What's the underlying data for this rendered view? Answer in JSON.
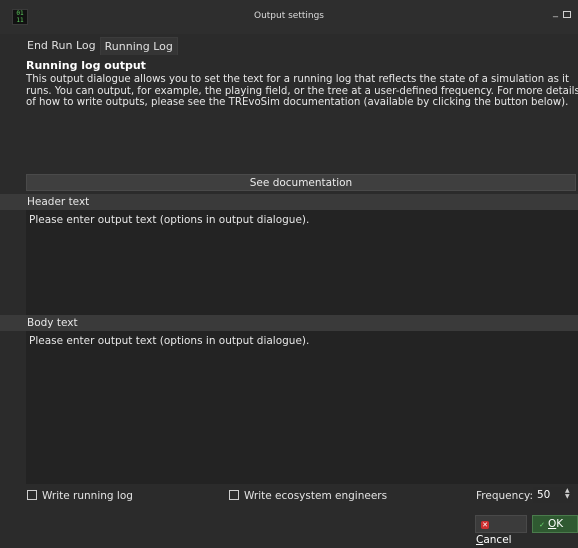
{
  "window": {
    "title": "Output settings",
    "app_icon_text": "01\n11"
  },
  "tabs": [
    {
      "label": "End Run Log",
      "active": false
    },
    {
      "label": "Running Log",
      "active": true
    }
  ],
  "panel": {
    "section_title": "Running log output",
    "description": "This output dialogue allows you to set the text for a running log that reflects the state of a simulation as it runs. You can output, for example, the playing field, or the tree at a user-defined frequency. For more details of how to write outputs, please see the TREvoSim documentation (available by clicking the button below).",
    "doc_button": "See documentation",
    "header_label": "Header text",
    "header_text": "Please enter output text (options in output dialogue).",
    "body_label": "Body text",
    "body_text": "Please enter output text (options in output dialogue)."
  },
  "options": {
    "write_running_log": {
      "label": "Write running log",
      "checked": false
    },
    "write_ecosystem_engineers": {
      "label": "Write ecosystem engineers",
      "checked": false
    },
    "frequency_label": "Frequency:",
    "frequency_value": "50"
  },
  "buttons": {
    "cancel_underlined": "C",
    "cancel_rest": "ancel",
    "ok_underlined": "O",
    "ok_rest": "K"
  },
  "icons": {
    "app": "terminal-icon",
    "cancel": "cancel-x-icon",
    "ok": "checkmark-icon"
  },
  "colors": {
    "background": "#2b2b2b",
    "label_bar": "#3a3a3a",
    "textarea": "#232323",
    "ok_button": "#2f5a31",
    "cancel_icon": "#cc2f2f"
  }
}
